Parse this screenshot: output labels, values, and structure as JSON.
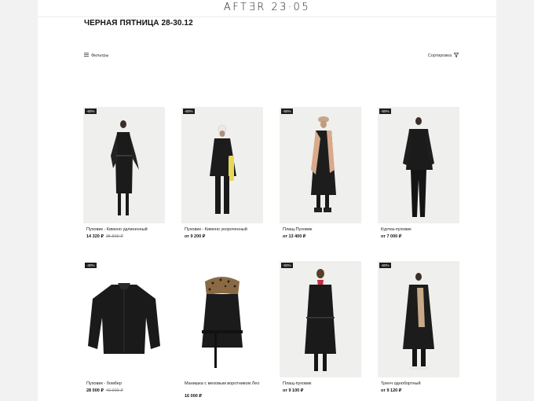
{
  "header": {
    "logo": "AFTƎR 23·05"
  },
  "page_title": "ЧЕРНАЯ ПЯТНИЦА 28-30.12",
  "toolbar": {
    "filters_label": "Фильтры",
    "sort_label": "Сортировка"
  },
  "products": [
    {
      "badge": "-60%",
      "name": "Пуховик - Кимоно удлиненный",
      "price": "14 320 ₽",
      "old_price": "35 800 ₽"
    },
    {
      "badge": "-60%",
      "name": "Пуховик - Кимоно укороченный",
      "price": "от  9 200 ₽",
      "old_price": ""
    },
    {
      "badge": "-50%",
      "name": "Плащ-Пуховик",
      "price": "от  13 400 ₽",
      "old_price": ""
    },
    {
      "badge": "-50%",
      "name": "Куртка-пуховик",
      "price": "от  7 000 ₽",
      "old_price": ""
    },
    {
      "badge": "-30%",
      "name": "Пуховик - бомбер",
      "price": "28 000 ₽",
      "old_price": "40 000 ₽"
    },
    {
      "badge": "",
      "name": "Манишка с меховым воротником Лео",
      "price": "16 000 ₽",
      "old_price": ""
    },
    {
      "badge": "-50%",
      "name": "Плащ-пуховик",
      "price": "от  9 100 ₽",
      "old_price": ""
    },
    {
      "badge": "-60%",
      "name": "Тренч однобортный",
      "price": "от  9 120 ₽",
      "old_price": ""
    }
  ],
  "icons": {
    "filters": "filter-lines-icon",
    "sort": "sort-funnel-icon"
  },
  "colors": {
    "badge_bg": "#1d1d1d",
    "photo_bg": "#efefed"
  }
}
